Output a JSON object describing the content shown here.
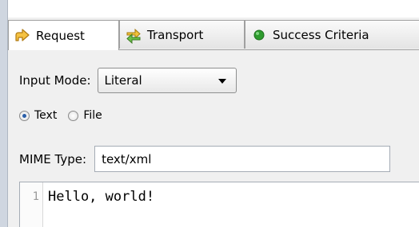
{
  "tabs": [
    {
      "label": "Request",
      "icon": "request-arrow-icon",
      "active": true
    },
    {
      "label": "Transport",
      "icon": "transport-arrows-icon",
      "active": false
    },
    {
      "label": "Success Criteria",
      "icon": "green-dot-icon",
      "active": false
    }
  ],
  "input_mode": {
    "label": "Input Mode:",
    "value": "Literal"
  },
  "source_radio": {
    "options": [
      {
        "label": "Text",
        "checked": true
      },
      {
        "label": "File",
        "checked": false
      }
    ]
  },
  "mime_type": {
    "label": "MIME Type:",
    "value": "text/xml"
  },
  "editor": {
    "line_number": "1",
    "line_text": "Hello, world!"
  },
  "colors": {
    "accent_radio": "#2a5ea8",
    "status_green": "#2e9b2e"
  }
}
